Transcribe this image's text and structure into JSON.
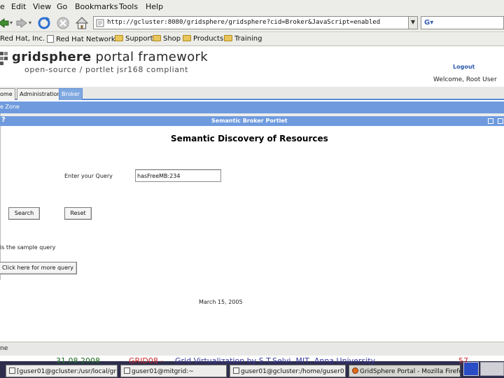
{
  "browser": {
    "menu": [
      "e",
      "Edit",
      "View",
      "Go",
      "Bookmarks",
      "Tools",
      "Help"
    ],
    "url": "http://gcluster:8080/gridsphere/gridsphere?cid=Broker&JavaScript=enabled",
    "bookmarks": [
      "Red Hat, Inc.",
      "Red Hat Network",
      "Support",
      "Shop",
      "Products",
      "Training"
    ]
  },
  "portal": {
    "logo_bold": "gridsphere",
    "logo_rest": " portal framework",
    "subtitle": "open-source / portlet jsr168 compliant",
    "logout": "Logout",
    "welcome": "Welcome, Root User"
  },
  "tabs": [
    "ome",
    "Administration",
    "Broker"
  ],
  "subnav": {
    "label": "e Zone"
  },
  "portlet": {
    "qmark": "?",
    "title": "Semantic Broker Portlet",
    "heading": "Semantic Discovery of Resources",
    "query_label": "Enter your Query",
    "query_value": "hasFreeMB:234",
    "search_button": "Search",
    "reset_button": "Reset",
    "sample_text": "is the sample query",
    "more_query_button": "Click here for more query"
  },
  "footer": {
    "date": "March 15, 2005",
    "status": "ne"
  },
  "slide": {
    "date": "31.08.2008",
    "conference": "GRID08 -",
    "author": "Grid Virtualization by S.T.Selvi, MIT, Anna University",
    "page": "57"
  },
  "taskbar": {
    "tasks": [
      "[guser01@gcluster:/usr/local/grid",
      "guser01@mitgrid:~",
      "guser01@gcluster:/home/guser0",
      "GridSphere Portal - Mozilla Firefo"
    ]
  },
  "colors": {
    "accent": "#6f9bde",
    "link": "#2c5aa8",
    "taskbar": "#2e2e4e"
  }
}
